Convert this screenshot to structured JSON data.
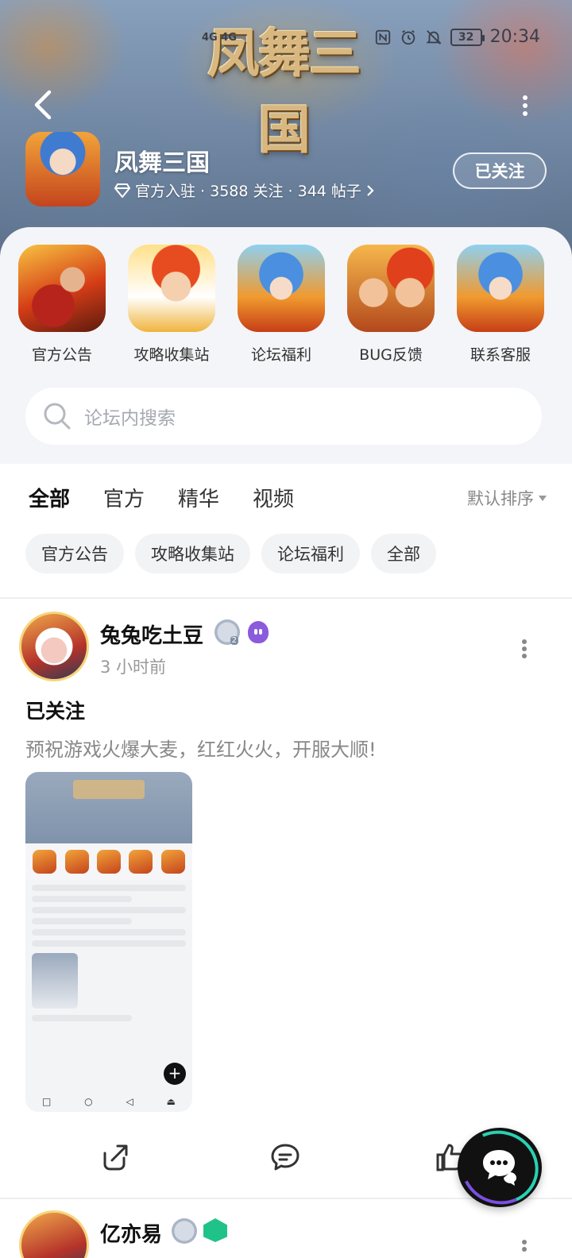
{
  "status_bar": {
    "signal": "4G 4G",
    "battery": "32",
    "time": "20:34"
  },
  "header": {
    "banner_logo": "凤舞三国",
    "game_name": "凤舞三国",
    "meta": "官方入驻 · 3588 关注 · 344 帖子",
    "follow_label": "已关注"
  },
  "features": [
    {
      "label": "官方公告"
    },
    {
      "label": "攻略收集站"
    },
    {
      "label": "论坛福利"
    },
    {
      "label": "BUG反馈"
    },
    {
      "label": "联系客服"
    }
  ],
  "search": {
    "placeholder": "论坛内搜索"
  },
  "tabs": [
    {
      "label": "全部",
      "active": true
    },
    {
      "label": "官方"
    },
    {
      "label": "精华"
    },
    {
      "label": "视频"
    }
  ],
  "sort_label": "默认排序",
  "chips": [
    {
      "label": "官方公告"
    },
    {
      "label": "攻略收集站"
    },
    {
      "label": "论坛福利"
    },
    {
      "label": "全部"
    }
  ],
  "post": {
    "username": "兔兔吃土豆",
    "level": "2",
    "time": "3 小时前",
    "title": "已关注",
    "body": "预祝游戏火爆大麦，红红火火，开服大顺!"
  },
  "post2": {
    "username": "亿亦易",
    "level": "2"
  },
  "colors": {
    "accent": "#2ad1b3",
    "panel_bg": "#f4f5f8",
    "chip_bg": "#f2f3f5",
    "muted_text": "#888888"
  }
}
